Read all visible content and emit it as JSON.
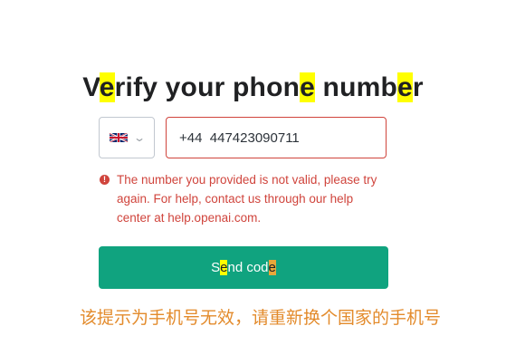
{
  "title": {
    "p1": "V",
    "h1": "e",
    "p2": "rify your phon",
    "h2": "e",
    "p3": " numb",
    "h3": "e",
    "p4": "r"
  },
  "country_selector": {
    "flag": "uk-flag-icon",
    "chevron": "chevron-down-icon"
  },
  "phone_field": {
    "value": "+44  447423090711"
  },
  "error": {
    "icon": "error-icon",
    "icon_glyph": "!",
    "message": "The number you provided is not valid, please try again. For help, contact us through our help center at help.openai.com."
  },
  "send_button": {
    "p1": "S",
    "h1": "e",
    "p2": "nd cod",
    "h2": "e"
  },
  "annotation": {
    "text": "该提示为手机号无效，请重新换个国家的手机号"
  },
  "colors": {
    "accent": "#10a37f",
    "error": "#d0443c",
    "highlight": "#ffff00",
    "annotation": "#e38b2c"
  }
}
